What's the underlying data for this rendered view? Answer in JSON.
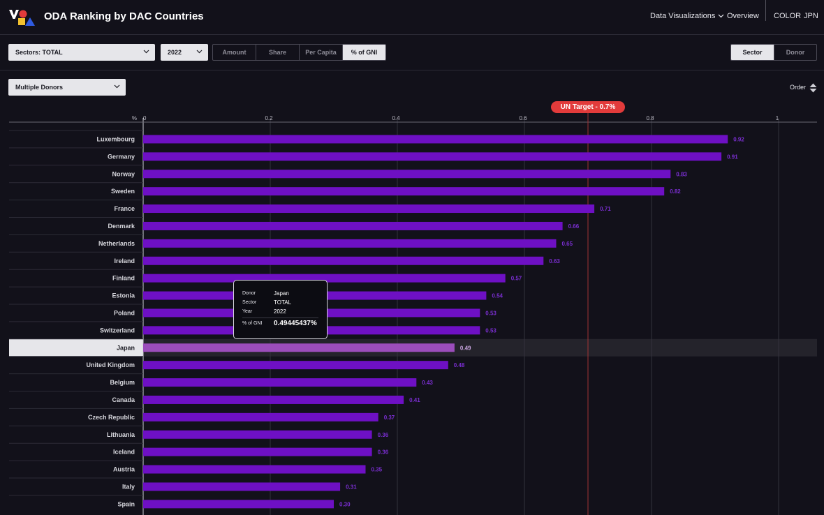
{
  "header": {
    "title": "ODA Ranking by DAC Countries",
    "nav": {
      "data_visualizations": "Data Visualizations",
      "overview": "Overview",
      "color": "COLOR",
      "language": "JPN"
    },
    "logo": {
      "colors": [
        "#ffffff",
        "#e23b3b",
        "#f2c12e",
        "#2f5be0"
      ]
    }
  },
  "filters": {
    "sector": "Sectors: TOTAL",
    "year": "2022",
    "metric_tabs": [
      "Amount",
      "Share",
      "Per Capita",
      "% of GNI"
    ],
    "metric_active": 3,
    "view_tabs": [
      "Sector",
      "Donor"
    ],
    "view_active": 0,
    "donor_select": "Multiple Donors",
    "order_label": "Order"
  },
  "un_target": {
    "label": "UN Target - 0.7%",
    "value": 0.7,
    "color": "#e23b3b"
  },
  "tooltip": {
    "donor_label": "Donor",
    "donor": "Japan",
    "sector_label": "Sector",
    "sector": "TOTAL",
    "year_label": "Year",
    "year": "2022",
    "value_label": "% of GNI",
    "value": "0.49445437%"
  },
  "colors": {
    "bar": "#6e10c4",
    "bar_highlight": "#9b4dbb",
    "value_label": "#7a2ed0",
    "background": "#12111a"
  },
  "chart_data": {
    "type": "bar",
    "orientation": "horizontal",
    "xlabel": "%",
    "xlim": [
      0,
      1
    ],
    "x_ticks": [
      "0",
      "0.2",
      "0.4",
      "0.6",
      "0.8",
      "1"
    ],
    "highlight": "Japan",
    "categories": [
      "Luxembourg",
      "Germany",
      "Norway",
      "Sweden",
      "France",
      "Denmark",
      "Netherlands",
      "Ireland",
      "Finland",
      "Estonia",
      "Poland",
      "Switzerland",
      "Japan",
      "United Kingdom",
      "Belgium",
      "Canada",
      "Czech Republic",
      "Lithuania",
      "Iceland",
      "Austria",
      "Italy",
      "Spain"
    ],
    "values": [
      0.92,
      0.91,
      0.83,
      0.82,
      0.71,
      0.66,
      0.65,
      0.63,
      0.57,
      0.54,
      0.53,
      0.53,
      0.49,
      0.48,
      0.43,
      0.41,
      0.37,
      0.36,
      0.36,
      0.35,
      0.31,
      0.3
    ],
    "value_labels": [
      "0.92",
      "0.91",
      "0.83",
      "0.82",
      "0.71",
      "0.66",
      "0.65",
      "0.63",
      "0.57",
      "0.54",
      "0.53",
      "0.53",
      "0.49",
      "0.48",
      "0.43",
      "0.41",
      "0.37",
      "0.36",
      "0.36",
      "0.35",
      "0.31",
      "0.30"
    ]
  }
}
